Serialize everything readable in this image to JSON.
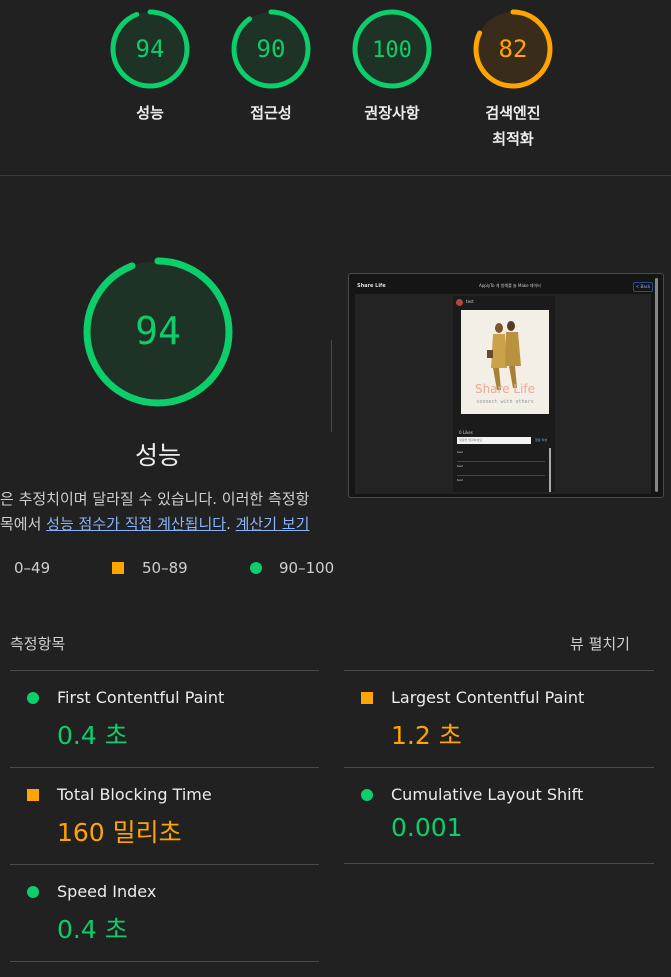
{
  "summary": {
    "gauges": [
      {
        "score": "94",
        "label": "성능",
        "color": "#0cce6b",
        "fraction": 0.94
      },
      {
        "score": "90",
        "label": "접근성",
        "color": "#0cce6b",
        "fraction": 0.9
      },
      {
        "score": "100",
        "label": "권장사항",
        "color": "#0cce6b",
        "fraction": 1.0
      },
      {
        "score": "82",
        "label_line1": "검색엔진",
        "label_line2": "최적화",
        "color": "#ffa400",
        "fraction": 0.82
      }
    ]
  },
  "performance": {
    "score": "94",
    "fraction": 0.94,
    "title": "성능",
    "desc_line1": "은 추정치이며 달라질 수 있습니다. 이러한 측정항",
    "desc_line2_prefix": "목에서 ",
    "desc_link1": "성능 점수가 직접 계산됩니다",
    "desc_period": ". ",
    "desc_link2": "계산기 보기"
  },
  "legend": {
    "fail": "0–49",
    "average": "50–89",
    "pass": "90–100"
  },
  "screenshot": {
    "app_name": "Share Life",
    "header_text": "ApplyTo 게 방해를 놀 Make 데이터",
    "button_text": "< Back",
    "user_name": "test",
    "poster_title": "Share Life",
    "poster_subtitle": "connect with others",
    "likes": "0 Likes",
    "comment_placeholder": "댓글을 입력하세요",
    "comment_button": "댓글 작성",
    "comments": [
      "test",
      "test",
      "test"
    ]
  },
  "metrics": {
    "section_title": "측정항목",
    "expand_label": "뷰 펼치기",
    "items": [
      {
        "name": "First Contentful Paint",
        "value": "0.4 초",
        "status": "pass"
      },
      {
        "name": "Largest Contentful Paint",
        "value": "1.2 초",
        "status": "average"
      },
      {
        "name": "Total Blocking Time",
        "value": "160 밀리초",
        "status": "average"
      },
      {
        "name": "Cumulative Layout Shift",
        "value": "0.001",
        "status": "pass"
      },
      {
        "name": "Speed Index",
        "value": "0.4 초",
        "status": "pass"
      }
    ]
  },
  "colors": {
    "pass": "#0cce6b",
    "average": "#ffa400",
    "background": "#212121"
  }
}
